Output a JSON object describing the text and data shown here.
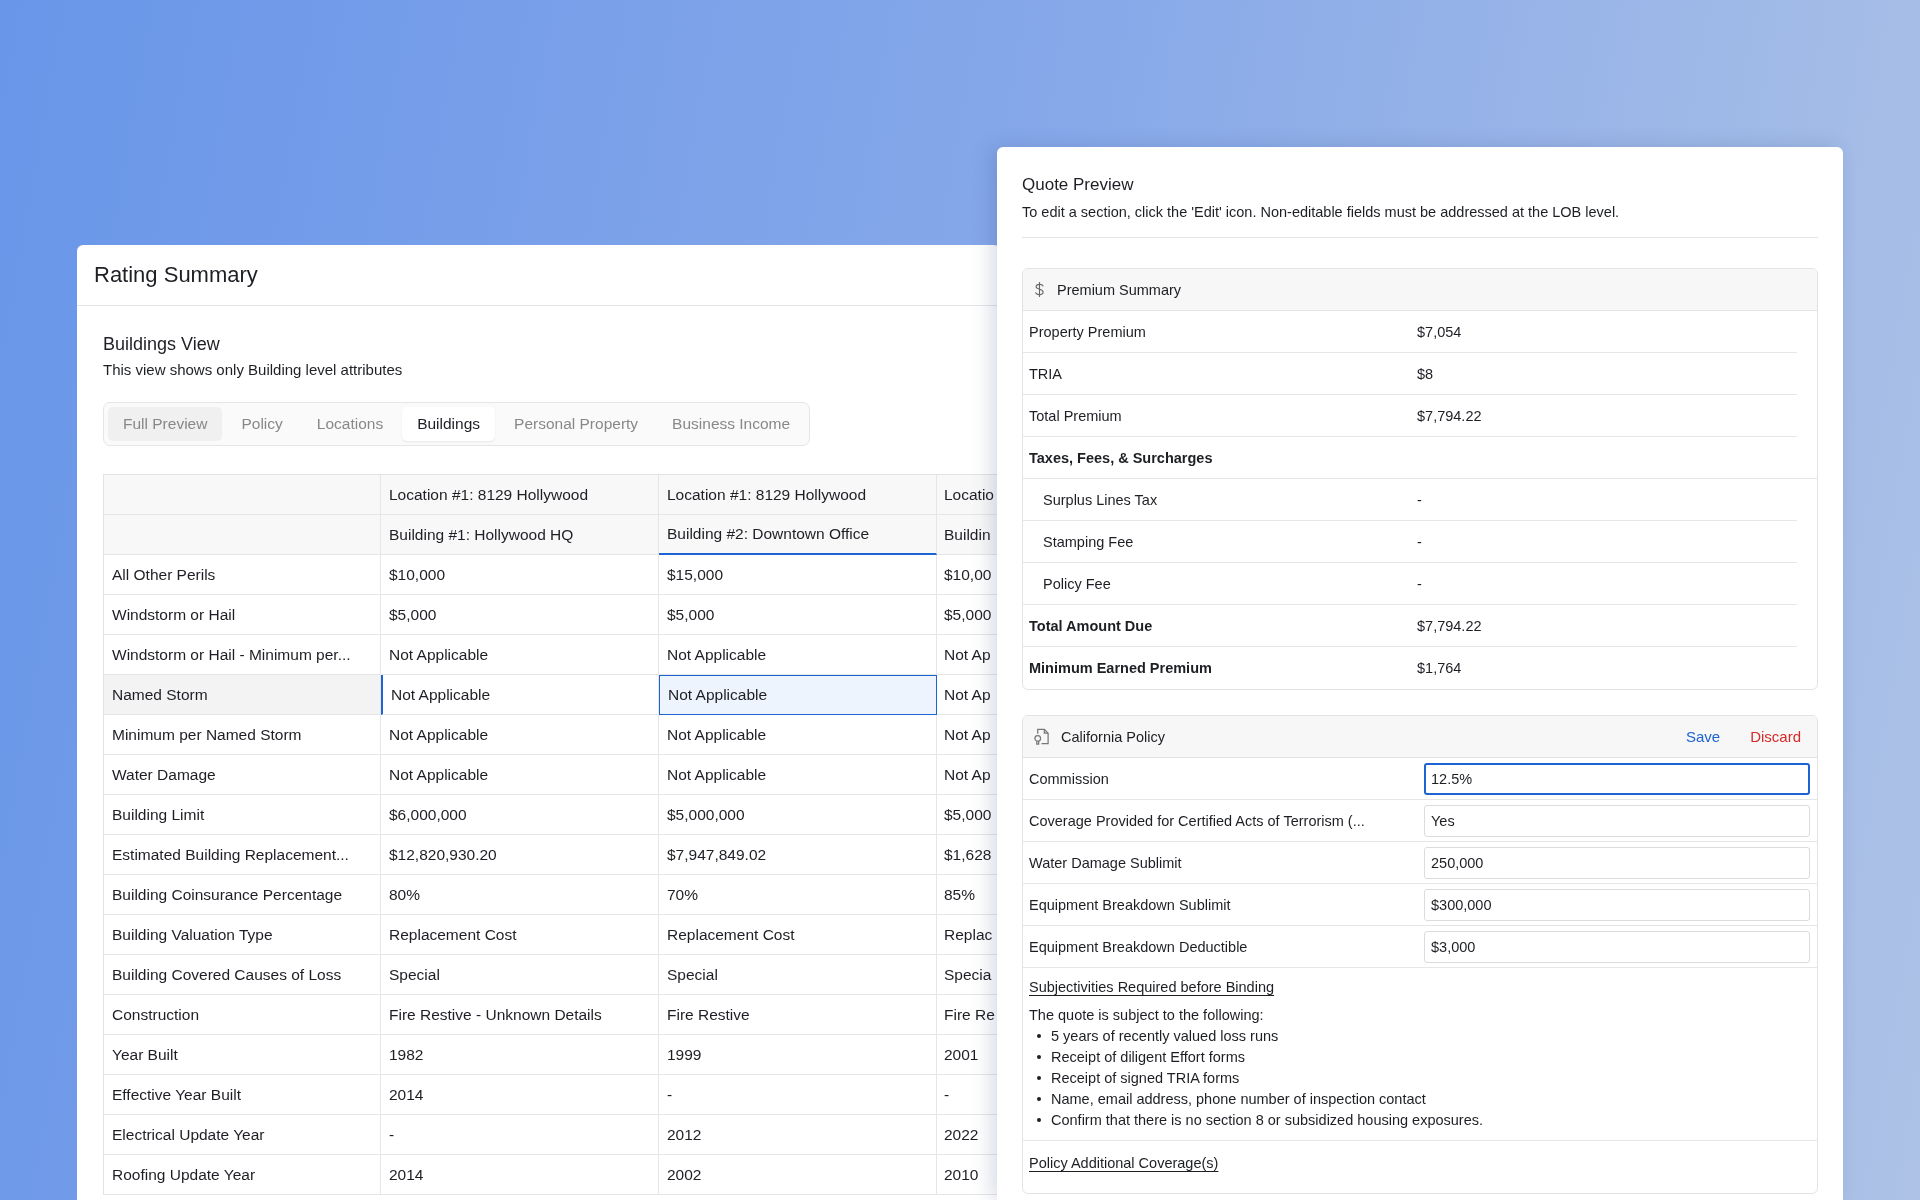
{
  "rating_summary": {
    "title": "Rating Summary",
    "view_title": "Buildings View",
    "view_description": "This view shows only Building level attributes",
    "tabs": [
      {
        "label": "Full Preview",
        "selected": false,
        "shaded": true
      },
      {
        "label": "Policy",
        "selected": false
      },
      {
        "label": "Locations",
        "selected": false
      },
      {
        "label": "Buildings",
        "selected": true
      },
      {
        "label": "Personal Property",
        "selected": false
      },
      {
        "label": "Business Income",
        "selected": false
      }
    ],
    "table": {
      "columns": [
        {
          "location": "Location #1: 8129 Hollywood",
          "building": "Building #1: Hollywood HQ",
          "selected": false
        },
        {
          "location": "Location #1: 8129 Hollywood",
          "building": "Building #2: Downtown Office",
          "selected": true
        },
        {
          "location": "Locatio",
          "building": "Buildin",
          "selected": false
        }
      ],
      "rows": [
        {
          "label": "All Other Perils",
          "selected": false,
          "cells": [
            "$10,000",
            "$15,000",
            "$10,00"
          ]
        },
        {
          "label": "Windstorm or Hail",
          "selected": false,
          "cells": [
            "$5,000",
            "$5,000",
            "$5,000"
          ]
        },
        {
          "label": "Windstorm or Hail - Minimum per...",
          "selected": false,
          "cells": [
            "Not Applicable",
            "Not Applicable",
            "Not Ap"
          ]
        },
        {
          "label": "Named Storm",
          "selected": true,
          "cells": [
            "Not Applicable",
            "Not Applicable",
            "Not Ap"
          ]
        },
        {
          "label": "Minimum per Named Storm",
          "selected": false,
          "cells": [
            "Not Applicable",
            "Not Applicable",
            "Not Ap"
          ]
        },
        {
          "label": "Water Damage",
          "selected": false,
          "cells": [
            "Not Applicable",
            "Not Applicable",
            "Not Ap"
          ]
        },
        {
          "label": "Building Limit",
          "selected": false,
          "cells": [
            "$6,000,000",
            "$5,000,000",
            "$5,000"
          ]
        },
        {
          "label": "Estimated Building Replacement...",
          "selected": false,
          "cells": [
            "$12,820,930.20",
            "$7,947,849.02",
            "$1,628"
          ]
        },
        {
          "label": "Building Coinsurance Percentage",
          "selected": false,
          "cells": [
            "80%",
            "70%",
            "85%"
          ]
        },
        {
          "label": "Building Valuation Type",
          "selected": false,
          "cells": [
            "Replacement Cost",
            "Replacement Cost",
            "Replac"
          ]
        },
        {
          "label": "Building Covered Causes of Loss",
          "selected": false,
          "cells": [
            "Special",
            "Special",
            "Specia"
          ]
        },
        {
          "label": "Construction",
          "selected": false,
          "cells": [
            "Fire Restive - Unknown Details",
            "Fire Restive",
            "Fire Re"
          ]
        },
        {
          "label": "Year Built",
          "selected": false,
          "cells": [
            "1982",
            "1999",
            "2001"
          ]
        },
        {
          "label": "Effective Year Built",
          "selected": false,
          "cells": [
            "2014",
            "-",
            "-"
          ]
        },
        {
          "label": "Electrical Update Year",
          "selected": false,
          "cells": [
            "-",
            "2012",
            "2022"
          ]
        },
        {
          "label": "Roofing Update Year",
          "selected": false,
          "cells": [
            "2014",
            "2002",
            "2010"
          ]
        }
      ]
    }
  },
  "quote_preview": {
    "title": "Quote Preview",
    "description": "To edit a section, click the 'Edit' icon. Non-editable fields must be addressed at the LOB level.",
    "premium_summary": {
      "title": "Premium Summary",
      "rows": [
        {
          "kind": "plain",
          "label": "Property Premium",
          "value": "$7,054"
        },
        {
          "kind": "plain",
          "label": "TRIA",
          "value": "$8"
        },
        {
          "kind": "plain",
          "label": "Total Premium",
          "value": "$7,794.22"
        },
        {
          "kind": "group",
          "label": "Taxes, Fees, & Surcharges"
        },
        {
          "kind": "sub",
          "label": "Surplus Lines Tax",
          "value": "-"
        },
        {
          "kind": "sub",
          "label": "Stamping Fee",
          "value": "-"
        },
        {
          "kind": "sub",
          "label": "Policy Fee",
          "value": "-"
        },
        {
          "kind": "total",
          "label": "Total Amount Due",
          "value": "$7,794.22"
        },
        {
          "kind": "total",
          "label": "Minimum Earned Premium",
          "value": "$1,764"
        }
      ]
    },
    "policy": {
      "title": "California Policy",
      "actions": [
        {
          "label": "Save",
          "kind": "save"
        },
        {
          "label": "Discard",
          "kind": "discard"
        }
      ],
      "fields": [
        {
          "label": "Commission",
          "value": "12.5%",
          "focused": true
        },
        {
          "label": "Coverage Provided for Certified Acts of Terrorism (...",
          "value": "Yes",
          "focused": false
        },
        {
          "label": "Water Damage Sublimit",
          "value": "250,000",
          "focused": false
        },
        {
          "label": "Equipment Breakdown Sublimit",
          "value": "$300,000",
          "focused": false
        },
        {
          "label": "Equipment Breakdown Deductible",
          "value": "$3,000",
          "focused": false
        }
      ],
      "subjectivities": {
        "heading": "Subjectivities Required before Binding",
        "intro": "The quote is subject to the following:",
        "items": [
          "5 years of recently valued loss runs",
          "Receipt of diligent Effort forms",
          "Receipt of signed TRIA forms",
          "Name, email address, phone number of inspection contact",
          "Confirm that there is no section 8 or subsidized housing exposures."
        ]
      },
      "additional_coverages": {
        "heading": "Policy Additional Coverage(s)"
      }
    }
  }
}
